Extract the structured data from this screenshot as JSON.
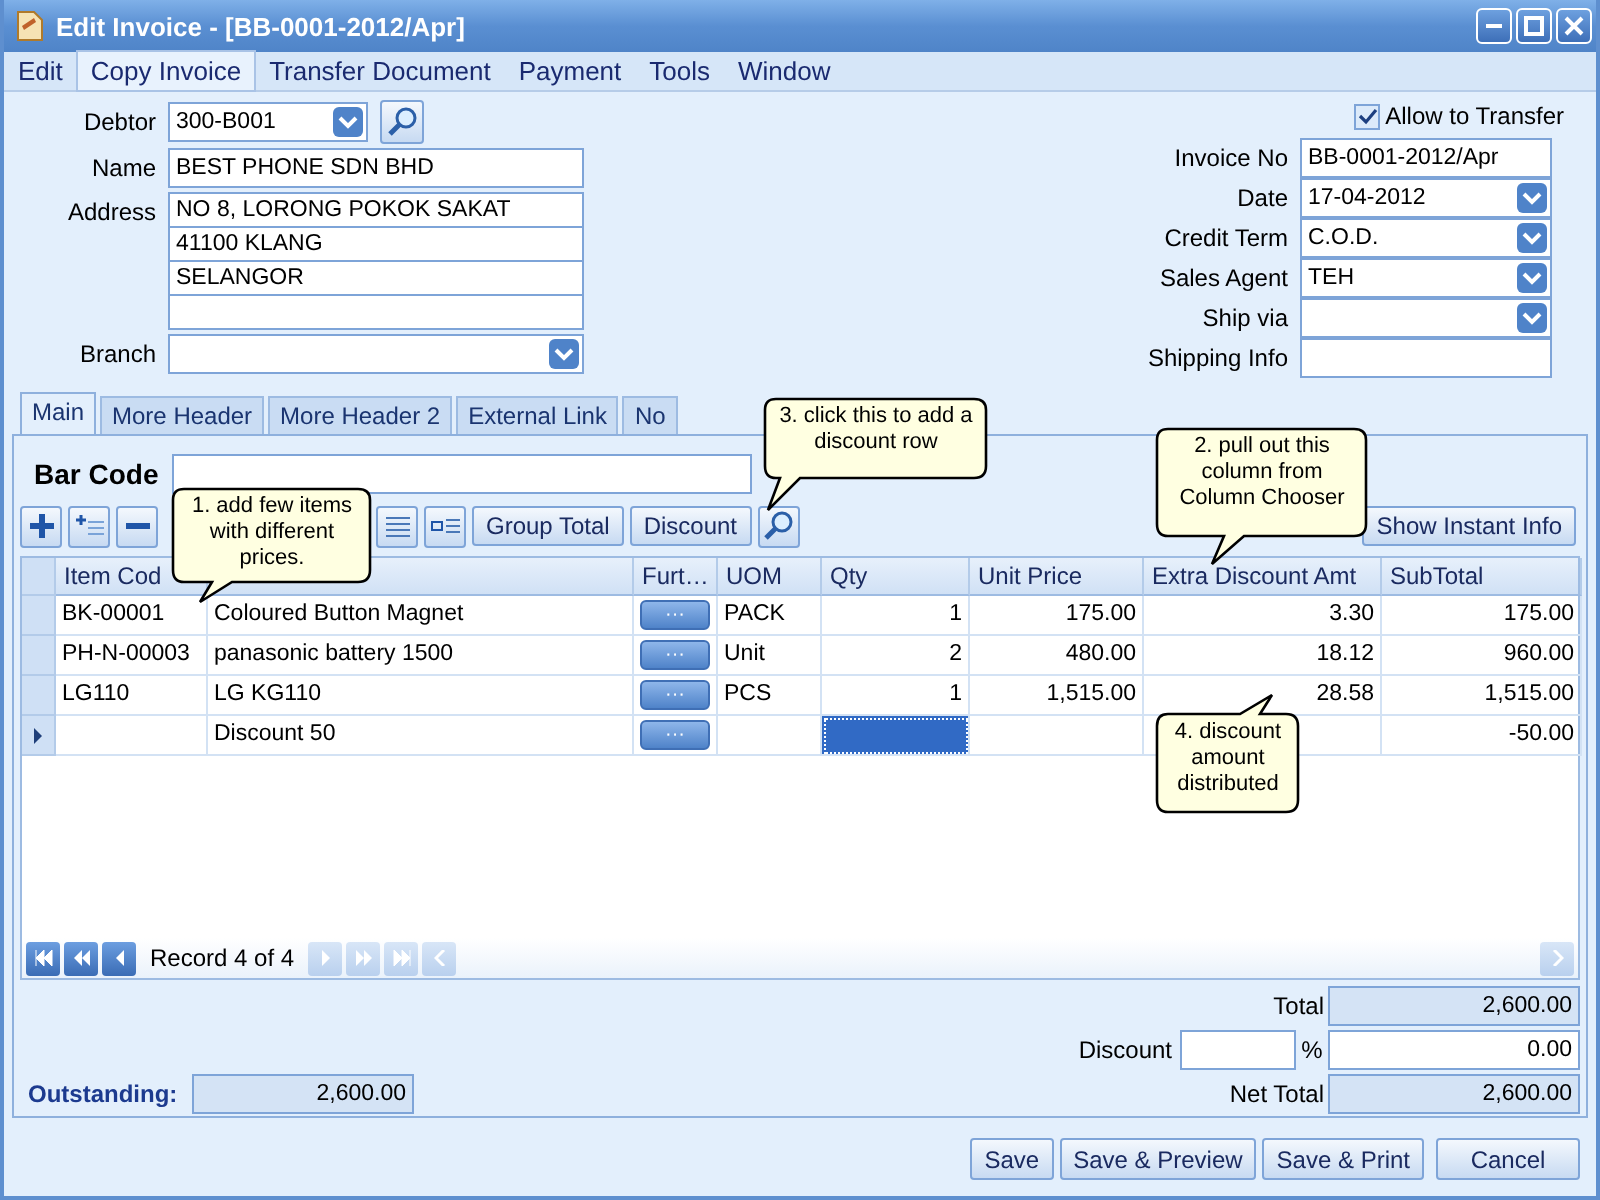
{
  "window": {
    "title": "Edit Invoice - [BB-0001-2012/Apr]"
  },
  "menu": [
    {
      "label": "Edit",
      "selected": false
    },
    {
      "label": "Copy Invoice",
      "selected": true
    },
    {
      "label": "Transfer Document",
      "selected": false
    },
    {
      "label": "Payment",
      "selected": false
    },
    {
      "label": "Tools",
      "selected": false
    },
    {
      "label": "Window",
      "selected": false
    }
  ],
  "left_fields": [
    {
      "label": "Debtor",
      "kind": "combo_search",
      "value": "300-B001"
    },
    {
      "label": "Name",
      "kind": "text",
      "value": "BEST PHONE SDN BHD"
    },
    {
      "label": "Address",
      "kind": "address",
      "lines": [
        "NO 8, LORONG POKOK SAKAT",
        "41100 KLANG",
        "SELANGOR"
      ]
    },
    {
      "label": "Branch",
      "kind": "combo"
    }
  ],
  "allow_transfer": {
    "label": "Allow to Transfer",
    "checked": true
  },
  "right_fields": [
    {
      "label": "Invoice No",
      "kind": "text",
      "value": "BB-0001-2012/Apr"
    },
    {
      "label": "Date",
      "kind": "combo",
      "value": "17-04-2012"
    },
    {
      "label": "Credit Term",
      "kind": "combo",
      "value": "C.O.D."
    },
    {
      "label": "Sales Agent",
      "kind": "combo",
      "value": "TEH"
    },
    {
      "label": "Ship via",
      "kind": "combo"
    },
    {
      "label": "Shipping Info",
      "kind": "text"
    }
  ],
  "tabs": [
    {
      "label": "Main",
      "selected": true
    },
    {
      "label": "More Header",
      "selected": false
    },
    {
      "label": "More Header 2",
      "selected": false
    },
    {
      "label": "External Link",
      "selected": false
    },
    {
      "label": "No",
      "selected": false
    }
  ],
  "bar_code": {
    "label": "Bar Code"
  },
  "toolbar": {
    "buttons": [
      "Group Total",
      "Discount"
    ],
    "instant_info": "Show Instant Info"
  },
  "grid": {
    "columns": [
      {
        "label": "Item Cod",
        "kind": "text"
      },
      {
        "kind": "text"
      },
      {
        "label": "Furt…",
        "kind": "button"
      },
      {
        "label": "UOM",
        "kind": "text"
      },
      {
        "label": "Qty",
        "kind": "text"
      },
      {
        "label": "Unit Price",
        "kind": "text"
      },
      {
        "label": "Extra Discount Amt",
        "kind": "text"
      },
      {
        "label": "SubTotal",
        "kind": "text"
      }
    ],
    "rows": [
      {
        "current": false,
        "qty_selected": false,
        "item_code": "BK-00001",
        "description": "Coloured Button Magnet",
        "further": "···",
        "uom": "PACK",
        "qty": "1",
        "unit_price": "175.00",
        "extra_discount": "3.30",
        "subtotal": "175.00"
      },
      {
        "current": false,
        "qty_selected": false,
        "item_code": "PH-N-00003",
        "description": "panasonic battery 1500",
        "further": "···",
        "uom": "Unit",
        "qty": "2",
        "unit_price": "480.00",
        "extra_discount": "18.12",
        "subtotal": "960.00"
      },
      {
        "current": false,
        "qty_selected": false,
        "item_code": "LG110",
        "description": "LG KG110",
        "further": "···",
        "uom": "PCS",
        "qty": "1",
        "unit_price": "1,515.00",
        "extra_discount": "28.58",
        "subtotal": "1,515.00"
      },
      {
        "current": true,
        "qty_selected": true,
        "description": "Discount 50",
        "further": "···",
        "subtotal": "-50.00"
      }
    ]
  },
  "navigator": {
    "text": "Record 4 of 4",
    "before": [
      {
        "disabled": false
      },
      {
        "disabled": false
      },
      {
        "disabled": false
      }
    ],
    "after": [
      {
        "disabled": true
      },
      {
        "disabled": true
      },
      {
        "disabled": true
      },
      {
        "disabled": true
      }
    ]
  },
  "totals": {
    "total_label": "Total",
    "total": "2,600.00",
    "discount_label": "Discount",
    "percent_sign": "%",
    "discount": "0.00",
    "net_total_label": "Net Total",
    "net_total": "2,600.00",
    "outstanding_label": "Outstanding:",
    "outstanding": "2,600.00"
  },
  "buttons": [
    "Save",
    "Save & Preview",
    "Save & Print",
    "Cancel"
  ],
  "callouts": [
    {
      "text": "1. add few items with different prices."
    },
    {
      "text": "2. pull out this column from Column Chooser"
    },
    {
      "text": "3. click this to add a discount row"
    },
    {
      "text": "4. discount amount distributed"
    }
  ]
}
